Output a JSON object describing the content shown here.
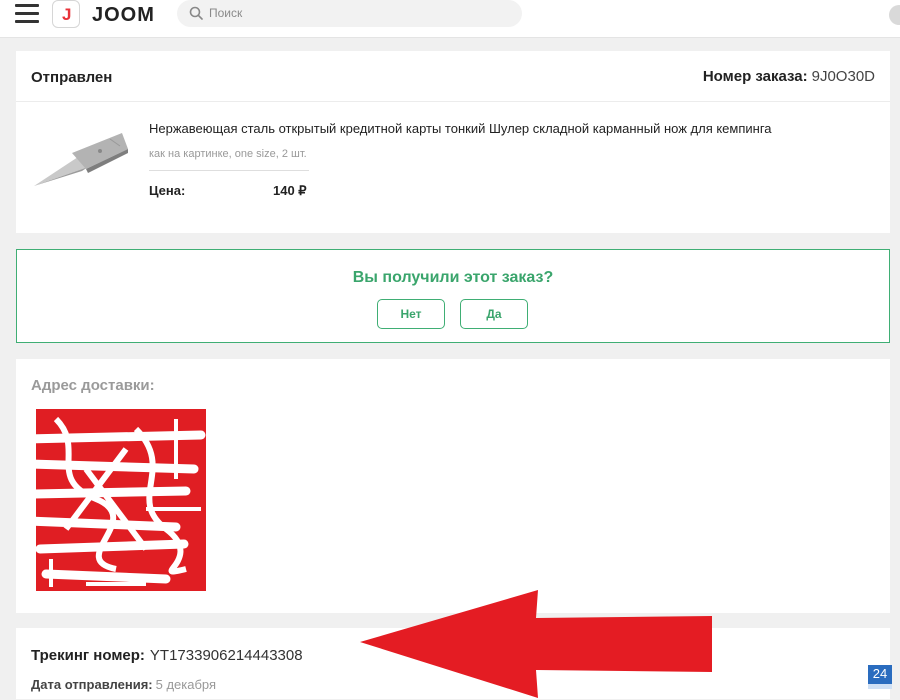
{
  "header": {
    "logo_letter": "J",
    "logo_text": "JOOM",
    "search_placeholder": "Поиск"
  },
  "order": {
    "status": "Отправлен",
    "number_label": "Номер заказа:",
    "number_value": "9J0O30D",
    "product": {
      "title": "Нержавеющая сталь открытый кредитной карты тонкий Шулер складной карманный нож для кемпинга",
      "variant": "как на картинке, one size, 2 шт.",
      "price_label": "Цена:",
      "price_value": "140 ₽"
    }
  },
  "confirm": {
    "question": "Вы получили этот заказ?",
    "no_label": "Нет",
    "yes_label": "Да",
    "accent_color": "#3aa56c"
  },
  "address": {
    "title": "Адрес доставки:"
  },
  "tracking": {
    "label": "Трекинг номер:",
    "value": "YT1733906214443308",
    "date_label": "Дата отправления:",
    "date_value": "5 декабря"
  },
  "badge": {
    "text": "24"
  }
}
